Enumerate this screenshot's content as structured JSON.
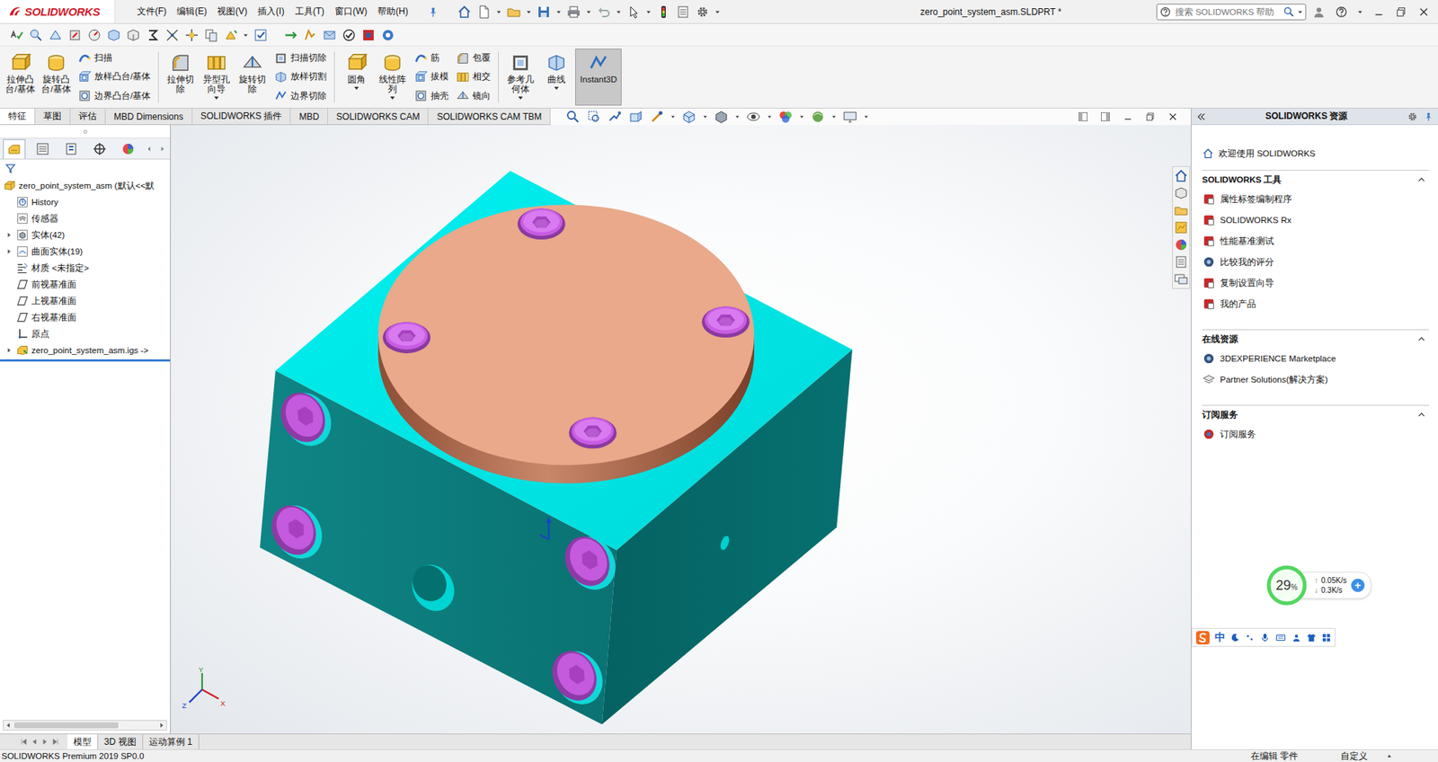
{
  "titlebar": {
    "logo": "SOLIDWORKS",
    "menus": [
      "文件(F)",
      "编辑(E)",
      "视图(V)",
      "插入(I)",
      "工具(T)",
      "窗口(W)",
      "帮助(H)"
    ],
    "title": "zero_point_system_asm.SLDPRT *",
    "search": {
      "placeholder": "搜索 SOLIDWORKS 帮助"
    }
  },
  "command_groups": [
    {
      "columns": [
        {
          "kind": "large",
          "label": "拉伸凸台/基体",
          "dropdown": false,
          "selected": false
        },
        {
          "kind": "large",
          "label": "旋转凸台/基体",
          "dropdown": false,
          "selected": false
        },
        {
          "kind": "stack",
          "items": [
            {
              "label": "扫描",
              "selected": false
            },
            {
              "label": "放样凸台/基体",
              "selected": false
            },
            {
              "label": "边界凸台/基体",
              "selected": false
            }
          ]
        }
      ]
    },
    {
      "columns": [
        {
          "kind": "large",
          "label": "拉伸切除",
          "dropdown": false,
          "selected": false
        },
        {
          "kind": "large",
          "label": "异型孔向导",
          "dropdown": true,
          "selected": false
        },
        {
          "kind": "large",
          "label": "旋转切除",
          "dropdown": false,
          "selected": false
        },
        {
          "kind": "stack",
          "items": [
            {
              "label": "扫描切除",
              "selected": false
            },
            {
              "label": "放样切割",
              "selected": false
            },
            {
              "label": "边界切除",
              "selected": false
            }
          ]
        }
      ]
    },
    {
      "columns": [
        {
          "kind": "large",
          "label": "圆角",
          "dropdown": true,
          "selected": false
        },
        {
          "kind": "large",
          "label": "线性阵列",
          "dropdown": true,
          "selected": false
        },
        {
          "kind": "stack",
          "items": [
            {
              "label": "筋",
              "selected": false
            },
            {
              "label": "拔模",
              "selected": false
            },
            {
              "label": "抽壳",
              "selected": false
            }
          ]
        },
        {
          "kind": "stack",
          "items": [
            {
              "label": "包覆",
              "selected": false
            },
            {
              "label": "相交",
              "selected": false
            },
            {
              "label": "镜向",
              "selected": false
            }
          ]
        }
      ]
    },
    {
      "columns": [
        {
          "kind": "large",
          "label": "参考几何体",
          "dropdown": true,
          "selected": false
        },
        {
          "kind": "large",
          "label": "曲线",
          "dropdown": true,
          "selected": false
        },
        {
          "kind": "large",
          "label": "Instant3D",
          "dropdown": false,
          "selected": true
        }
      ]
    }
  ],
  "tabs": [
    {
      "label": "特征",
      "selected": true
    },
    {
      "label": "草图",
      "selected": false
    },
    {
      "label": "评估",
      "selected": false
    },
    {
      "label": "MBD Dimensions",
      "selected": false
    },
    {
      "label": "SOLIDWORKS 插件",
      "selected": false
    },
    {
      "label": "MBD",
      "selected": false
    },
    {
      "label": "SOLIDWORKS CAM",
      "selected": false
    },
    {
      "label": "SOLIDWORKS CAM TBM",
      "selected": false
    }
  ],
  "tree": {
    "root": "zero_point_system_asm  (默认<<默",
    "items": [
      {
        "label": "History",
        "kind": "history",
        "expandable": false,
        "expanded": false
      },
      {
        "label": "传感器",
        "kind": "sensor",
        "expandable": false,
        "expanded": false
      },
      {
        "label": "实体(42)",
        "kind": "solid",
        "expandable": true,
        "expanded": false
      },
      {
        "label": "曲面实体(19)",
        "kind": "surface",
        "expandable": true,
        "expanded": false
      },
      {
        "label": "材质 <未指定>",
        "kind": "material",
        "expandable": false,
        "expanded": false
      },
      {
        "label": "前视基准面",
        "kind": "plane",
        "expandable": false,
        "expanded": false
      },
      {
        "label": "上视基准面",
        "kind": "plane",
        "expandable": false,
        "expanded": false
      },
      {
        "label": "右视基准面",
        "kind": "plane",
        "expandable": false,
        "expanded": false
      },
      {
        "label": "原点",
        "kind": "origin",
        "expandable": false,
        "expanded": false
      },
      {
        "label": "zero_point_system_asm.igs ->",
        "kind": "import",
        "expandable": true,
        "expanded": false
      }
    ]
  },
  "bottom_tabs": [
    {
      "label": "模型",
      "selected": true
    },
    {
      "label": "3D 视图",
      "selected": false
    },
    {
      "label": "运动算例 1",
      "selected": false
    }
  ],
  "resources": {
    "title": "SOLIDWORKS 资源",
    "welcome": "欢迎使用  SOLIDWORKS",
    "sections": [
      {
        "title": "SOLIDWORKS 工具",
        "expanded": true,
        "items": [
          "属性标签编制程序",
          "SOLIDWORKS Rx",
          "性能基准测试",
          "比较我的评分",
          "复制设置向导",
          "我的产品"
        ]
      },
      {
        "title": "在线资源",
        "expanded": true,
        "items": [
          "3DEXPERIENCE Marketplace",
          "Partner Solutions(解决方案)"
        ]
      },
      {
        "title": "订阅服务",
        "expanded": true,
        "items": [
          "订阅服务"
        ]
      }
    ]
  },
  "triad": {
    "x": "X",
    "y": "Y",
    "z": "Z"
  },
  "status_bar": {
    "left": "SOLIDWORKS Premium 2019 SP0.0",
    "mode": "在编辑 零件",
    "units": "自定义"
  },
  "net_widget": {
    "percent": "29",
    "unit": "%",
    "up_arrow": "↑",
    "up": "0.05K/s",
    "down_arrow": "↓",
    "down": "0.3K/s",
    "plus": "+"
  },
  "ime": {
    "lang": "中"
  }
}
